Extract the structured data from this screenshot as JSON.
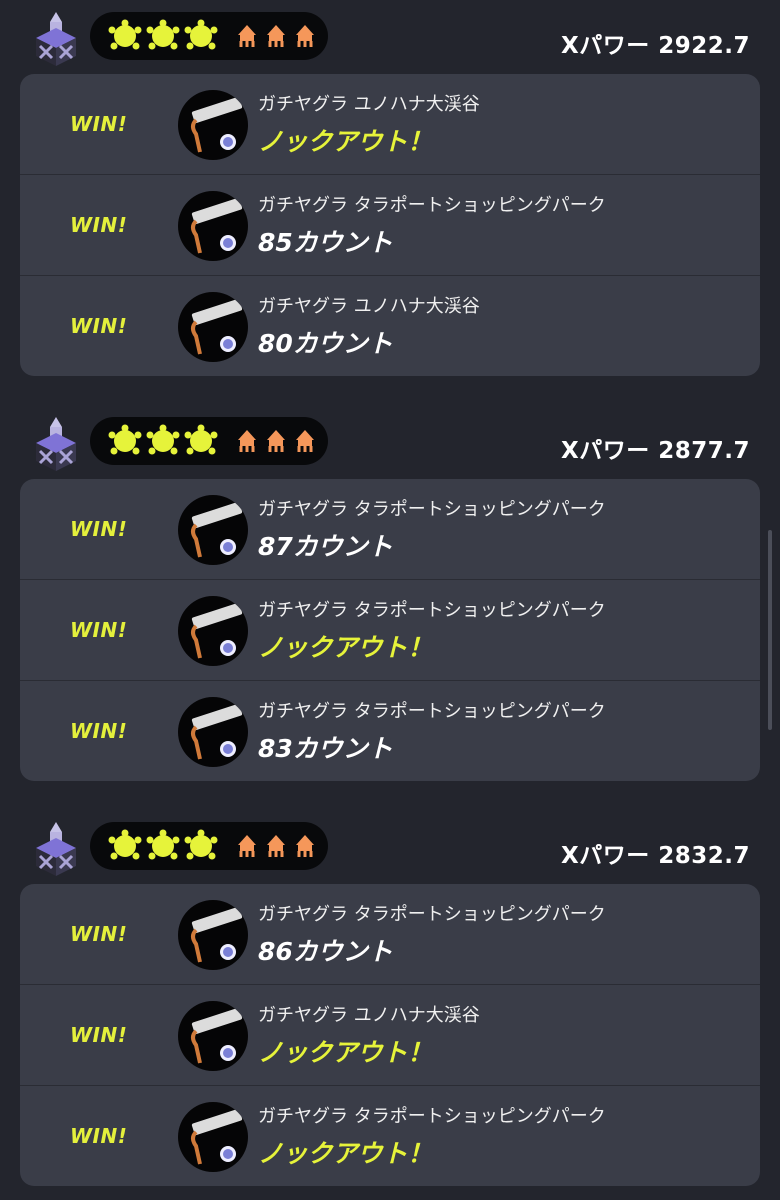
{
  "colors": {
    "background": "#23252d",
    "card": "#3a3d48",
    "accent_yellow": "#e6f33a",
    "squid_orange": "#f5975a"
  },
  "icons": {
    "mode": "tower-control-icon",
    "win_marker": "splat-icon",
    "team": "squid-icon",
    "weapon": "inkbrush-weapon-icon"
  },
  "sets": [
    {
      "xpower": "Xパワー 2922.7",
      "matches": [
        {
          "result_label": "WIN!",
          "stage": "ガチヤグラ ユノハナ大渓谷",
          "outcome": "ノックアウト！",
          "knockout": true
        },
        {
          "result_label": "WIN!",
          "stage": "ガチヤグラ タラポートショッピングパーク",
          "outcome": "85カウント",
          "knockout": false
        },
        {
          "result_label": "WIN!",
          "stage": "ガチヤグラ ユノハナ大渓谷",
          "outcome": "80カウント",
          "knockout": false
        }
      ]
    },
    {
      "xpower": "Xパワー 2877.7",
      "matches": [
        {
          "result_label": "WIN!",
          "stage": "ガチヤグラ タラポートショッピングパーク",
          "outcome": "87カウント",
          "knockout": false
        },
        {
          "result_label": "WIN!",
          "stage": "ガチヤグラ タラポートショッピングパーク",
          "outcome": "ノックアウト！",
          "knockout": true
        },
        {
          "result_label": "WIN!",
          "stage": "ガチヤグラ タラポートショッピングパーク",
          "outcome": "83カウント",
          "knockout": false
        }
      ]
    },
    {
      "xpower": "Xパワー 2832.7",
      "matches": [
        {
          "result_label": "WIN!",
          "stage": "ガチヤグラ タラポートショッピングパーク",
          "outcome": "86カウント",
          "knockout": false
        },
        {
          "result_label": "WIN!",
          "stage": "ガチヤグラ ユノハナ大渓谷",
          "outcome": "ノックアウト！",
          "knockout": true
        },
        {
          "result_label": "WIN!",
          "stage": "ガチヤグラ タラポートショッピングパーク",
          "outcome": "ノックアウト！",
          "knockout": true
        }
      ]
    }
  ]
}
